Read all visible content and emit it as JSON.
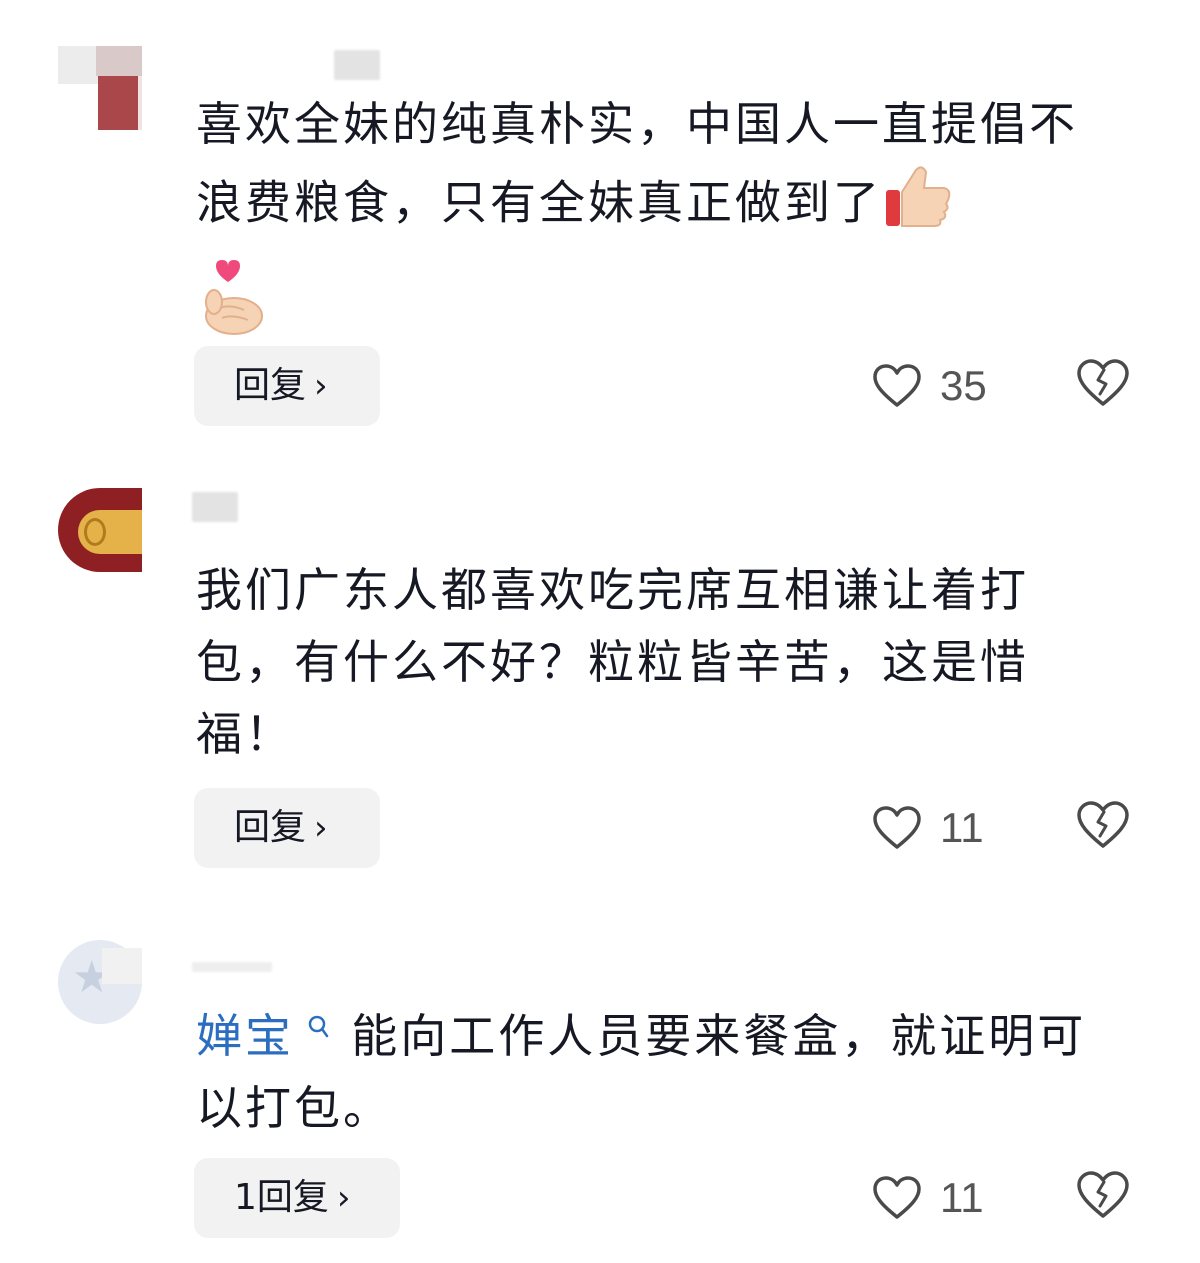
{
  "comments": [
    {
      "text": "喜欢全妹的纯真朴实，中国人一直提倡不浪费粮食，只有全妹真正做到了",
      "emojis": [
        "thumbs-up",
        "finger-heart"
      ],
      "reply_label": "回复",
      "likes": "35"
    },
    {
      "text": "我们广东人都喜欢吃完席互相谦让着打包，有什么不好？粒粒皆辛苦，这是惜福！",
      "reply_label": "回复",
      "likes": "11"
    },
    {
      "mention": "婵宝",
      "text": "能向工作人员要来餐盒，就证明可以打包。",
      "reply_label": "1回复",
      "likes": "11"
    }
  ],
  "icons": {
    "chevron": "›",
    "like": "heart-outline-icon",
    "dislike": "broken-heart-icon",
    "mention": "search-icon"
  }
}
